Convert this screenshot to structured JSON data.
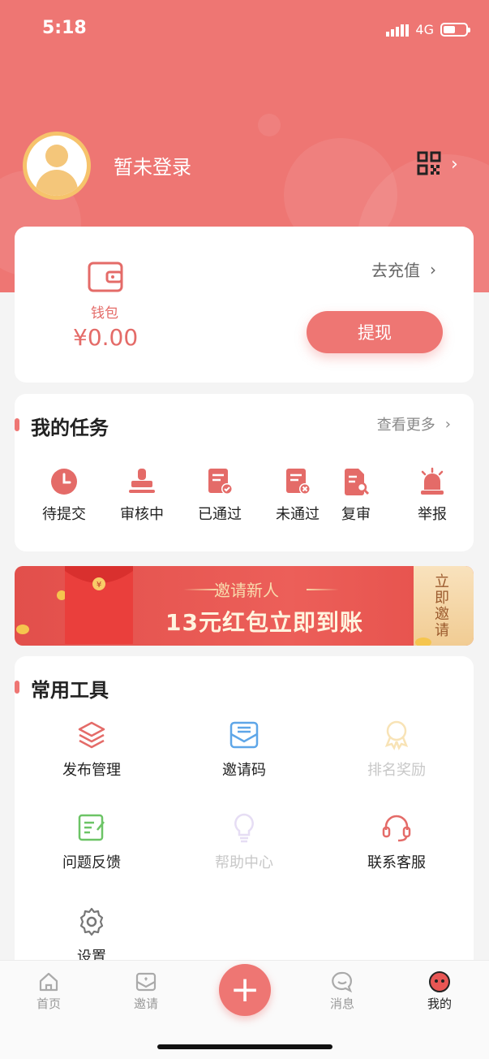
{
  "status_bar": {
    "time": "5:18",
    "network": "4G"
  },
  "profile": {
    "login_status": "暂未登录"
  },
  "wallet": {
    "label": "钱包",
    "amount": "¥0.00",
    "recharge_label": "去充值",
    "withdraw_label": "提现"
  },
  "tasks": {
    "title": "我的任务",
    "more_label": "查看更多",
    "items": [
      {
        "label": "待提交",
        "icon": "clock-icon"
      },
      {
        "label": "审核中",
        "icon": "stamp-icon"
      },
      {
        "label": "已通过",
        "icon": "doc-approved-icon"
      },
      {
        "label": "未通过",
        "icon": "doc-rejected-icon"
      },
      {
        "label": "复审",
        "icon": "doc-search-icon"
      },
      {
        "label": "举报",
        "icon": "alarm-icon"
      }
    ]
  },
  "banner": {
    "subtitle": "邀请新人",
    "headline": "13元红包立即到账",
    "cta": "立即邀请"
  },
  "tools": {
    "title": "常用工具",
    "items": [
      {
        "label": "发布管理",
        "icon": "layers-icon"
      },
      {
        "label": "邀请码",
        "icon": "envelope-icon"
      },
      {
        "label": "排名奖励",
        "icon": "medal-icon"
      },
      {
        "label": "问题反馈",
        "icon": "edit-icon"
      },
      {
        "label": "帮助中心",
        "icon": "lightbulb-icon"
      },
      {
        "label": "联系客服",
        "icon": "headset-icon"
      },
      {
        "label": "设置",
        "icon": "gear-icon"
      }
    ]
  },
  "tab_bar": {
    "tabs": [
      {
        "label": "首页",
        "icon": "home-icon"
      },
      {
        "label": "邀请",
        "icon": "invite-icon"
      },
      {
        "label": "消息",
        "icon": "message-icon"
      },
      {
        "label": "我的",
        "icon": "profile-icon"
      }
    ],
    "center_symbol": "+",
    "active": "我的"
  },
  "colors": {
    "primary": "#ee7673",
    "icon_red": "#e46b68",
    "text": "#222222",
    "muted": "#999999"
  }
}
